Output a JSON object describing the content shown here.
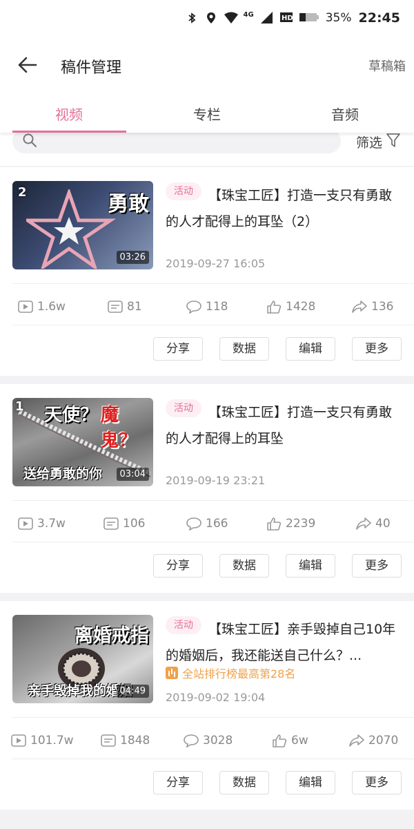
{
  "status_bar": {
    "network": "4G",
    "battery": "35%",
    "time": "22:45"
  },
  "header": {
    "title": "稿件管理",
    "drafts_label": "草稿箱"
  },
  "tabs": [
    {
      "label": "视频"
    },
    {
      "label": "专栏"
    },
    {
      "label": "音频"
    }
  ],
  "search": {
    "filter_label": "筛选"
  },
  "colors": {
    "accent": "#e46f96",
    "rank": "#f0a14a"
  },
  "videos": [
    {
      "thumb_rank": "2",
      "thumb_caption": "勇敢",
      "duration": "03:26",
      "badge": "活动",
      "title": "【珠宝工匠】打造一支只有勇敢的人才配得上的耳坠（2）",
      "date": "2019-09-27 16:05",
      "stats": {
        "views": "1.6w",
        "danmaku": "81",
        "comments": "118",
        "likes": "1428",
        "shares": "136"
      }
    },
    {
      "thumb_rank": "1",
      "thumb_caption_a": "天使？",
      "thumb_caption_b": "魔鬼？",
      "thumb_sub": "送给勇敢的你",
      "duration": "03:04",
      "badge": "活动",
      "title": "【珠宝工匠】打造一支只有勇敢的人才配得上的耳坠",
      "date": "2019-09-19 23:21",
      "stats": {
        "views": "3.7w",
        "danmaku": "106",
        "comments": "166",
        "likes": "2239",
        "shares": "40"
      }
    },
    {
      "thumb_caption": "离婚戒指",
      "thumb_sub": "亲手毁掉我的婚姻",
      "duration": "04:49",
      "badge": "活动",
      "title": "【珠宝工匠】亲手毁掉自己10年的婚姻后，我还能送自己什么？...",
      "rank_text": "全站排行榜最高第28名",
      "date": "2019-09-02 19:04",
      "stats": {
        "views": "101.7w",
        "danmaku": "1848",
        "comments": "3028",
        "likes": "6w",
        "shares": "2070"
      }
    }
  ],
  "actions": {
    "share": "分享",
    "data": "数据",
    "edit": "编辑",
    "more": "更多"
  }
}
